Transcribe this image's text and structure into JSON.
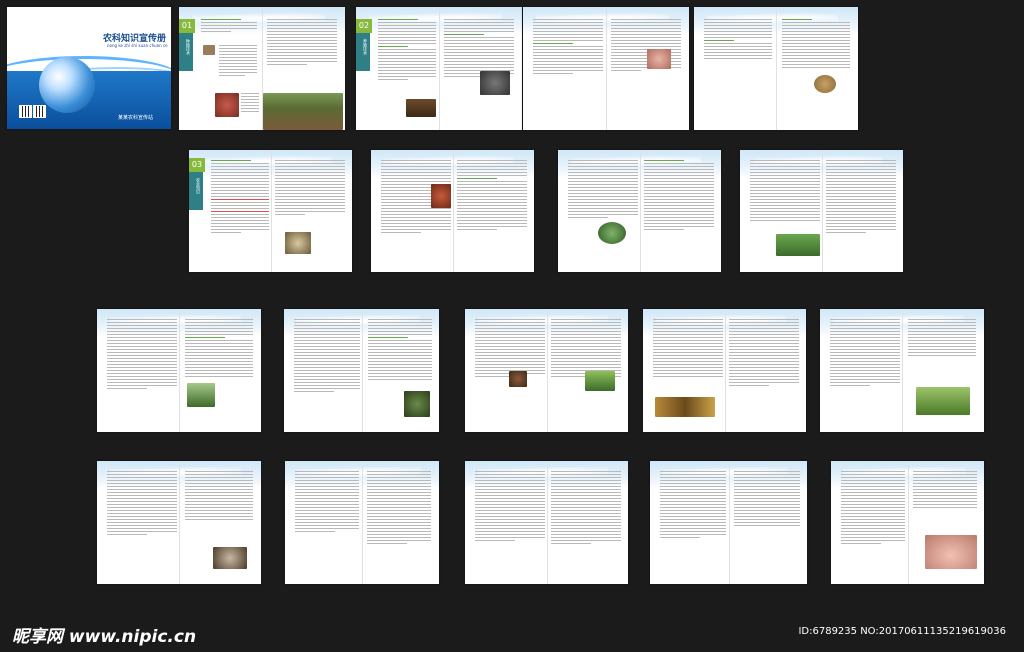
{
  "cover": {
    "title": "农科知识宣传册",
    "subtitle": "nong ke zhi shi xuan chuan ce",
    "publisher": "某某农科宣传站"
  },
  "sections": [
    {
      "number": "01",
      "label": "种植技术"
    },
    {
      "number": "02",
      "label": "养殖技术"
    },
    {
      "number": "03",
      "label": "农业知识"
    }
  ],
  "watermark": {
    "logo": "昵享网 www.nipic.cn",
    "id": "ID:6789235 NO:20170611135219619036"
  },
  "colors": {
    "background": "#1b1b1b",
    "tab_green": "#86b93c",
    "tab_teal": "#2f7f86",
    "cover_blue": "#0a4f9c"
  }
}
